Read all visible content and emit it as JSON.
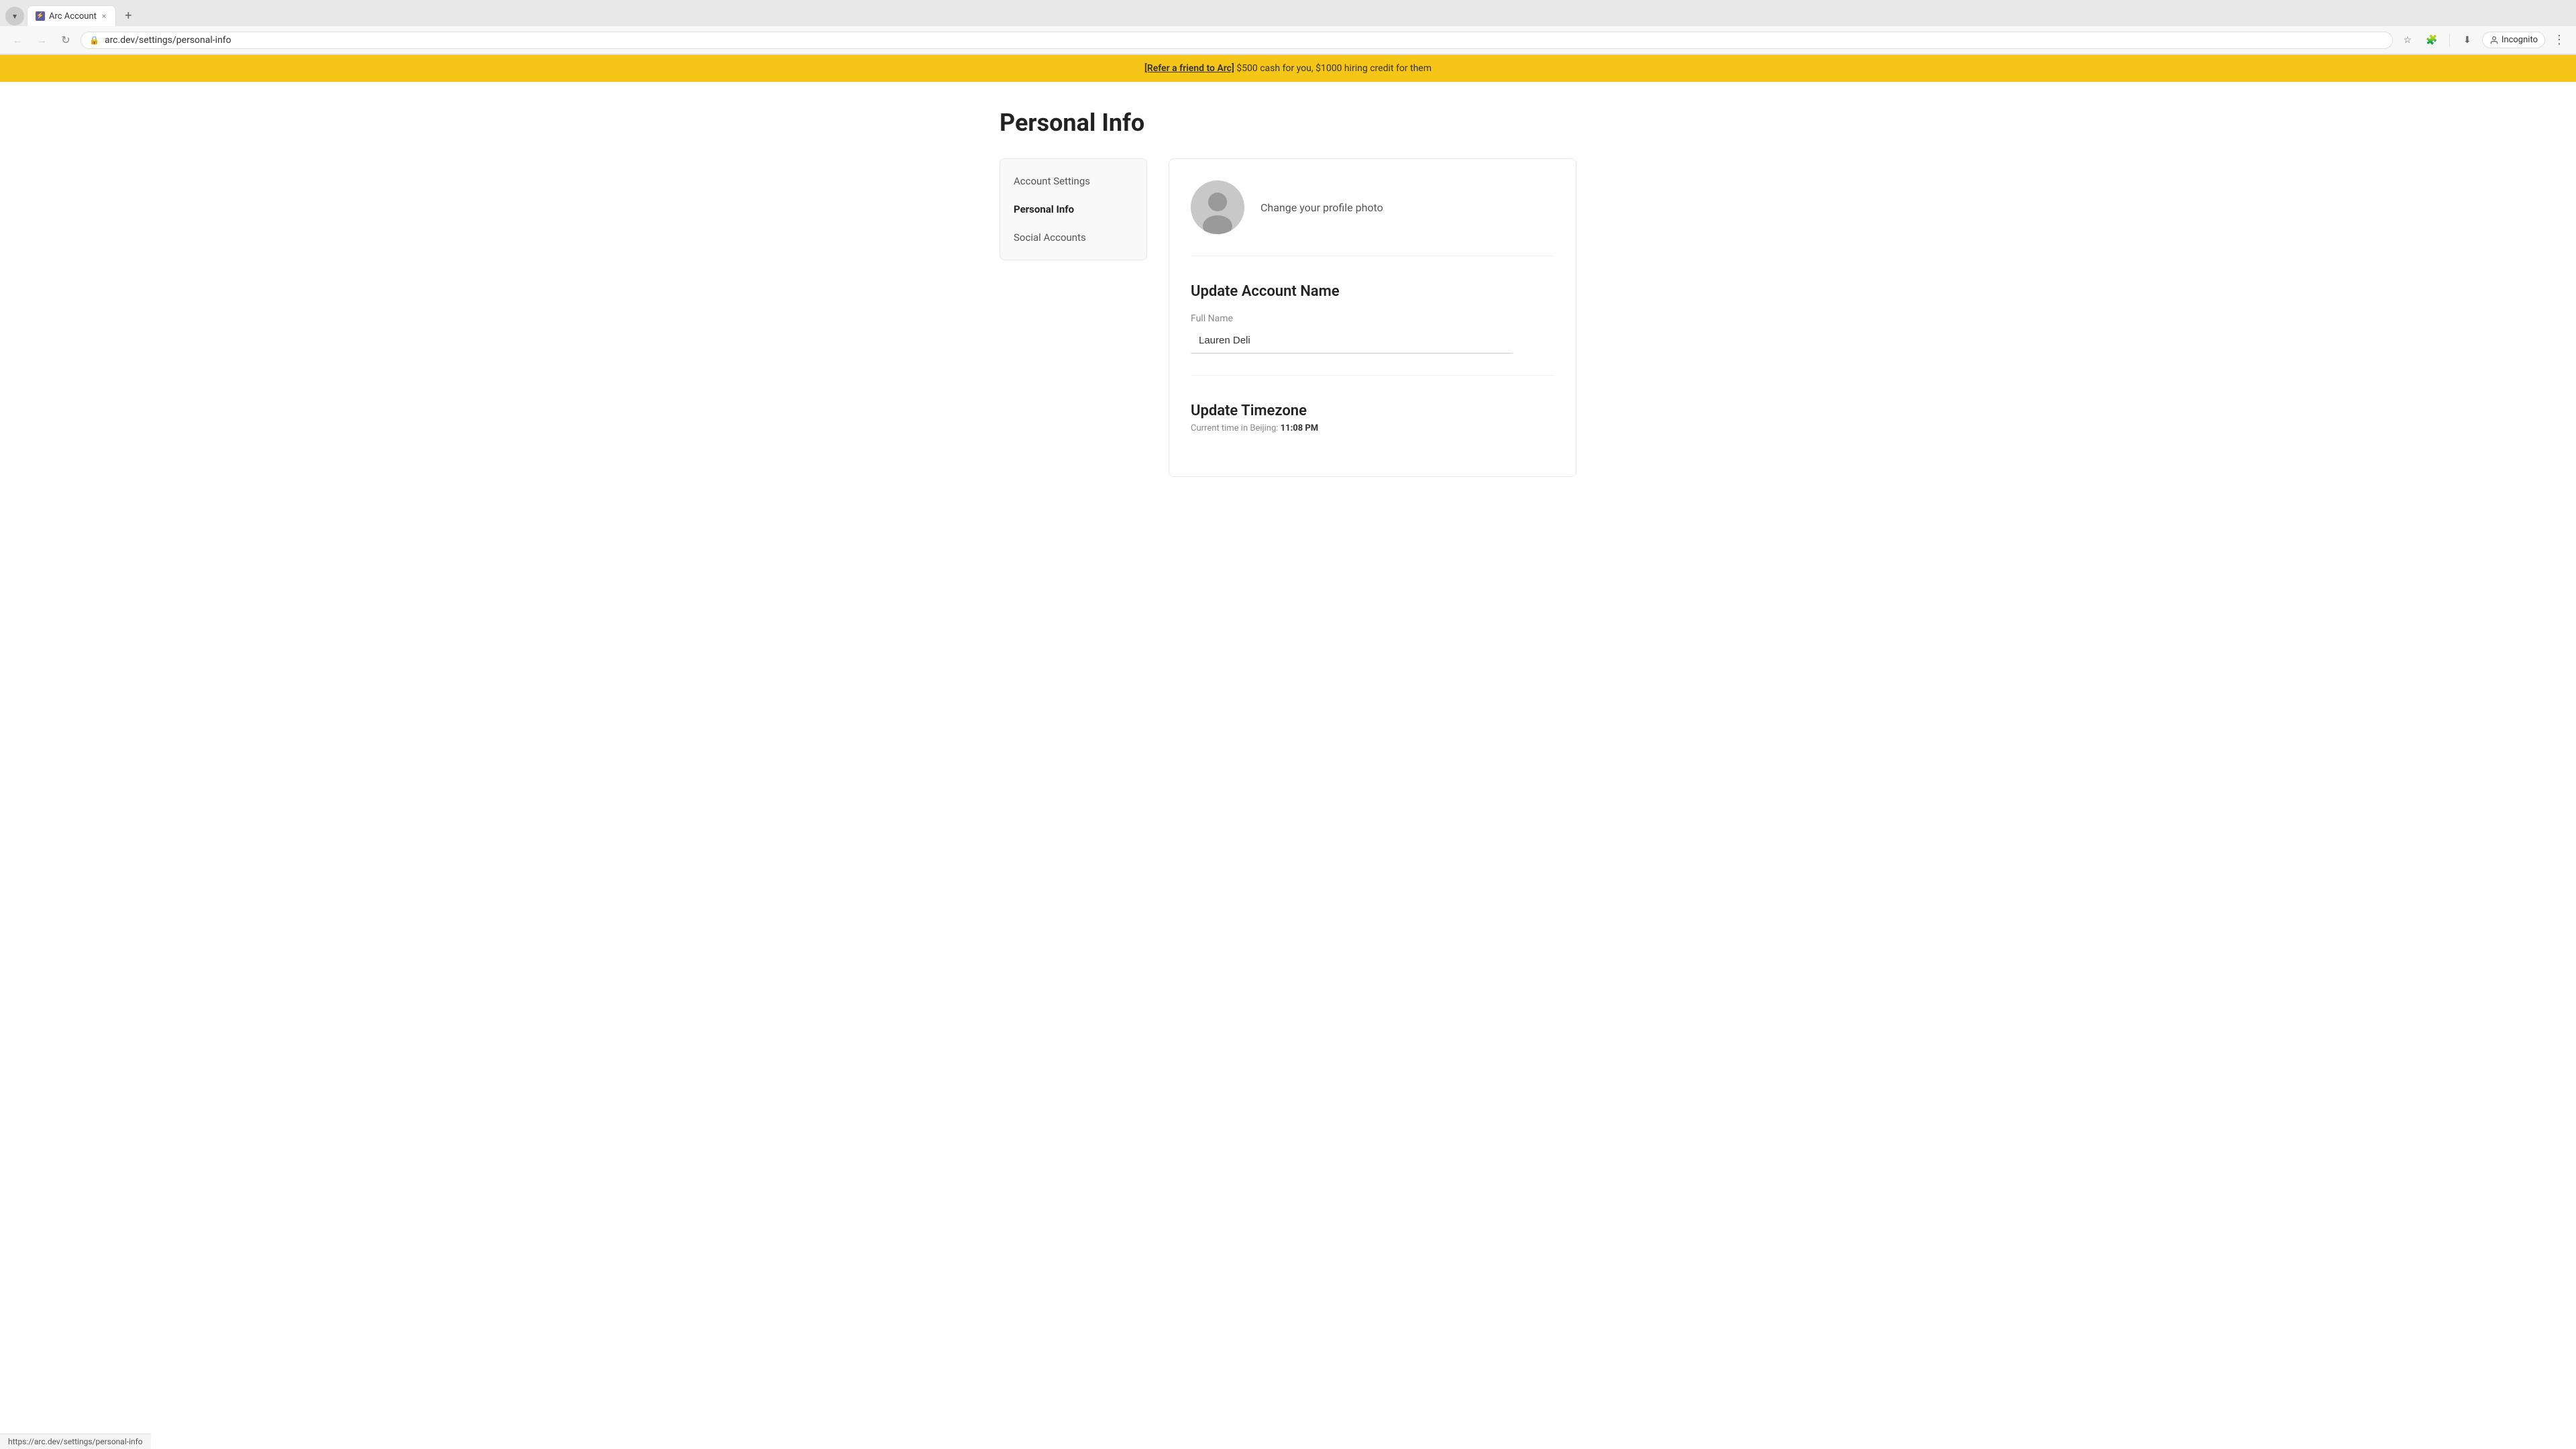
{
  "browser": {
    "tab": {
      "favicon_label": "Arc",
      "title": "Arc Account",
      "close_label": "×"
    },
    "add_tab_label": "+",
    "nav": {
      "back_label": "←",
      "forward_label": "→",
      "reload_label": "↻",
      "address": "arc.dev/settings/personal-info",
      "address_icon": "🔒",
      "bookmark_label": "☆",
      "extensions_label": "🧩",
      "download_label": "⬇",
      "incognito_label": "Incognito",
      "more_label": "⋮"
    }
  },
  "banner": {
    "link_text": "[Refer a friend to Arc]",
    "text": " $500 cash for you, $1000 hiring credit for them"
  },
  "page": {
    "title": "Personal Info"
  },
  "sidebar": {
    "items": [
      {
        "label": "Account Settings",
        "active": false
      },
      {
        "label": "Personal Info",
        "active": true
      },
      {
        "label": "Social Accounts",
        "active": false
      }
    ]
  },
  "profile": {
    "change_photo_text": "Change your profile photo"
  },
  "update_name": {
    "section_title": "Update Account Name",
    "field_label": "Full Name",
    "field_value": "Lauren Deli"
  },
  "update_timezone": {
    "section_title": "Update Timezone",
    "timezone_label": "Current time in Beijing:",
    "timezone_time": "11:08 PM"
  },
  "status_bar": {
    "url": "https://arc.dev/settings/personal-info"
  }
}
